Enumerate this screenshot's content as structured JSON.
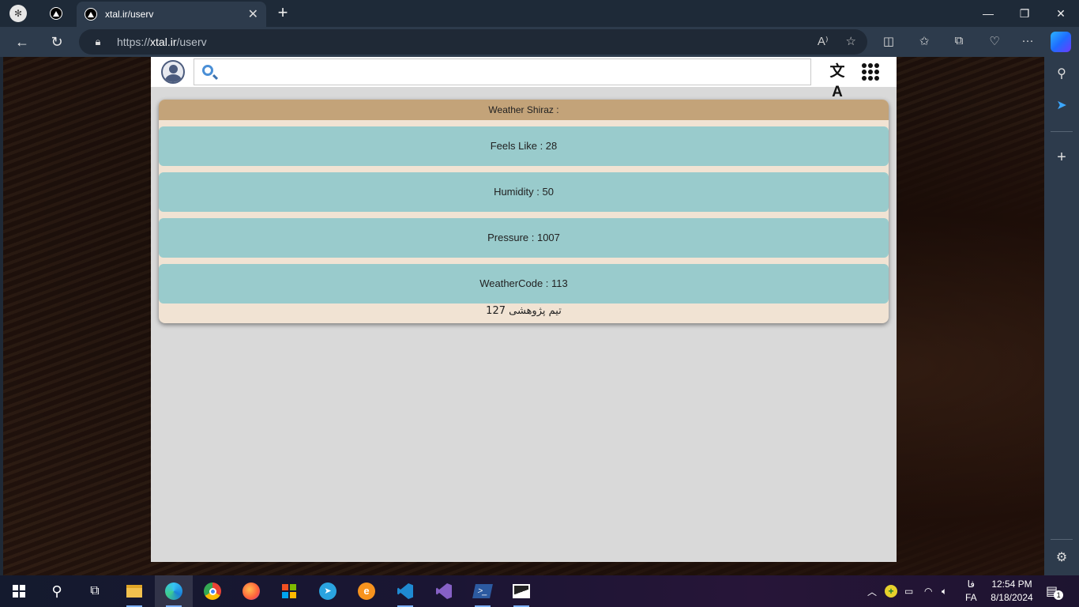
{
  "browser": {
    "tab_title": "xtal.ir/userv",
    "tab_close": "✕",
    "new_tab": "+",
    "url_scheme": "https://",
    "url_host": "xtal.ir",
    "url_path": "/userv",
    "window_controls": {
      "minimize": "—",
      "restore": "❐",
      "close": "✕"
    }
  },
  "app": {
    "search_placeholder": "",
    "translate_icon": "文A",
    "card": {
      "title": "Weather Shiraz :",
      "rows": [
        {
          "label": "Feels Like : 28"
        },
        {
          "label": "Humidity : 50"
        },
        {
          "label": "Pressure : 1007"
        },
        {
          "label": "WeatherCode : 113"
        }
      ],
      "footer": "تیم پژوهشی 127"
    }
  },
  "taskbar": {
    "lang_top": "فا",
    "lang_bottom": "FA",
    "time": "12:54 PM",
    "date": "8/18/2024",
    "notifications": "1"
  },
  "colors": {
    "card_header": "#c3a379",
    "card_body": "#f1e3d3",
    "row": "#99cbcc",
    "app_bg": "#d9d9d9"
  }
}
